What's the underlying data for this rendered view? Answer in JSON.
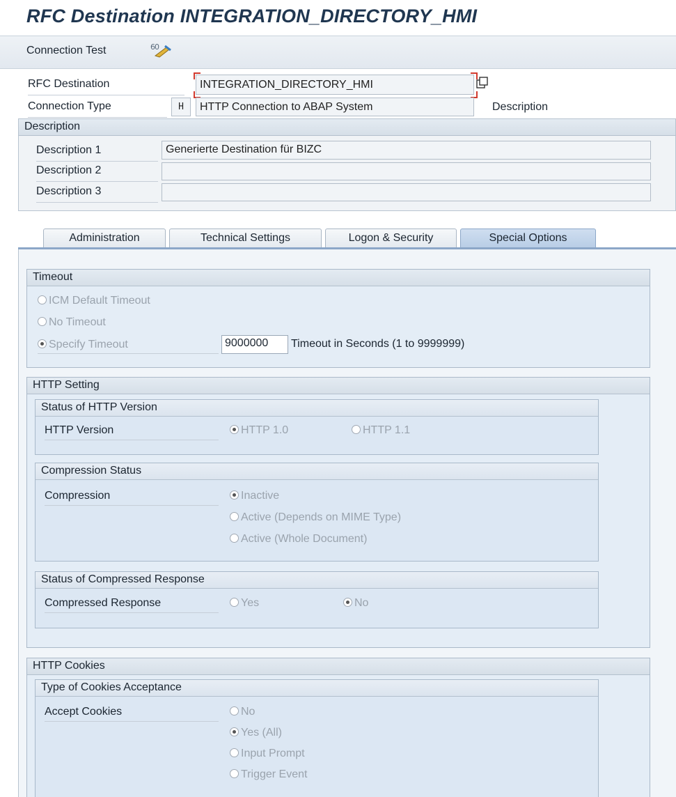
{
  "title": "RFC Destination INTEGRATION_DIRECTORY_HMI",
  "toolbar": {
    "connection_test": "Connection Test",
    "icon": "connection-test-icon"
  },
  "header": {
    "rfc_destination_label": "RFC Destination",
    "rfc_destination_value": "INTEGRATION_DIRECTORY_HMI",
    "connection_type_label": "Connection Type",
    "connection_type_code": "H",
    "connection_type_value": "HTTP Connection to ABAP System",
    "description_link": "Description"
  },
  "description_group": {
    "title": "Description",
    "rows": [
      {
        "label": "Description 1",
        "value": "Generierte Destination für BIZC"
      },
      {
        "label": "Description 2",
        "value": ""
      },
      {
        "label": "Description 3",
        "value": ""
      }
    ]
  },
  "tabs": [
    "Administration",
    "Technical Settings",
    "Logon & Security",
    "Special Options"
  ],
  "active_tab": "Special Options",
  "timeout": {
    "title": "Timeout",
    "options": [
      "ICM Default Timeout",
      "No Timeout",
      "Specify Timeout"
    ],
    "selected": "Specify Timeout",
    "value": "9000000",
    "unit_text": "Timeout in Seconds (1 to 9999999)"
  },
  "http_setting": {
    "title": "HTTP Setting",
    "version": {
      "title": "Status of HTTP Version",
      "label": "HTTP Version",
      "options": [
        "HTTP 1.0",
        "HTTP 1.1"
      ],
      "selected": "HTTP 1.0"
    },
    "compression": {
      "title": "Compression Status",
      "label": "Compression",
      "options": [
        "Inactive",
        "Active (Depends on MIME Type)",
        "Active (Whole Document)"
      ],
      "selected": "Inactive"
    },
    "compressed_response": {
      "title": "Status of Compressed Response",
      "label": "Compressed Response",
      "options": [
        "Yes",
        "No"
      ],
      "selected": "No"
    }
  },
  "http_cookies": {
    "title": "HTTP Cookies",
    "acceptance": {
      "title": "Type of Cookies Acceptance",
      "label": "Accept Cookies",
      "options": [
        "No",
        "Yes (All)",
        "Input Prompt",
        "Trigger Event"
      ],
      "selected": "Yes (All)"
    }
  },
  "colors": {
    "title": "#1f3650",
    "active_tab": "#b8cde6",
    "focus": "#d23a2e"
  }
}
